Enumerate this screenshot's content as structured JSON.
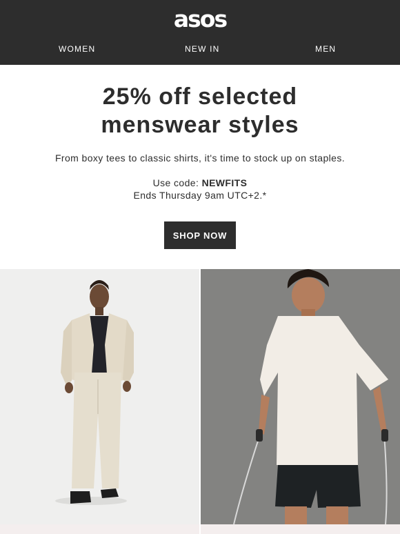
{
  "brand": {
    "logo_text": "asos"
  },
  "nav": {
    "items": [
      {
        "label": "WOMEN"
      },
      {
        "label": "NEW IN"
      },
      {
        "label": "MEN"
      }
    ]
  },
  "hero": {
    "headline_line1": "25% off selected",
    "headline_line2": "menswear styles",
    "subline": "From boxy tees to classic shirts, it's time to stock up on staples.",
    "code_prefix": "Use code: ",
    "code": "NEWFITS",
    "ends": "Ends Thursday 9am UTC+2.*",
    "cta_label": "SHOP NOW"
  },
  "colors": {
    "header_bg": "#2d2d2d",
    "text": "#2d2d2d",
    "cta_bg": "#2d2d2d",
    "cta_text": "#ffffff"
  }
}
